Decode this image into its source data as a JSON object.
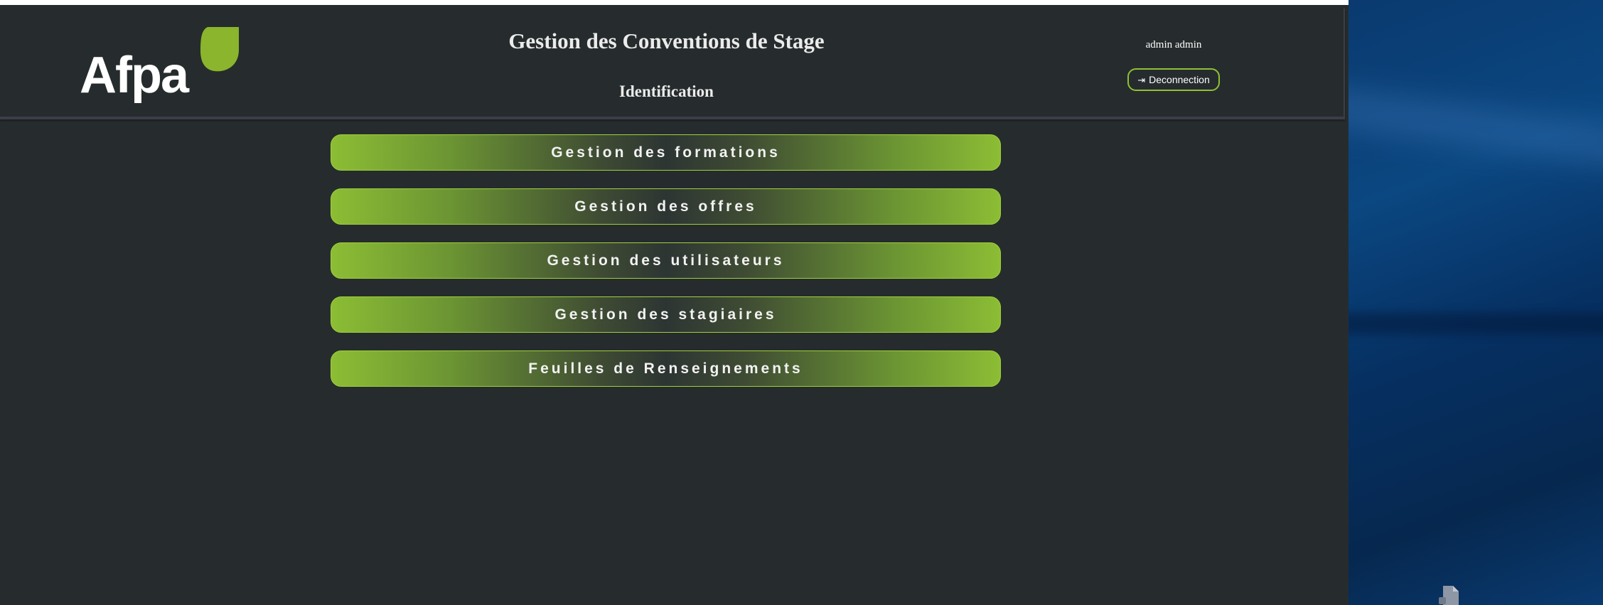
{
  "header": {
    "logo_text": "Afpa",
    "title": "Gestion des Conventions de Stage",
    "subtitle": "Identification",
    "user_name": "admin admin",
    "logout_icon": "sign-out-icon",
    "logout_label": "Deconnection"
  },
  "menu": {
    "items": [
      {
        "label": "Gestion des formations"
      },
      {
        "label": "Gestion des offres"
      },
      {
        "label": "Gestion des utilisateurs"
      },
      {
        "label": "Gestion des stagiaires"
      },
      {
        "label": "Feuilles de Renseignements"
      }
    ]
  },
  "colors": {
    "background": "#262c2d",
    "accent": "#8cbd34",
    "header_border": "#3d3c49",
    "desktop": "#0b4781"
  }
}
